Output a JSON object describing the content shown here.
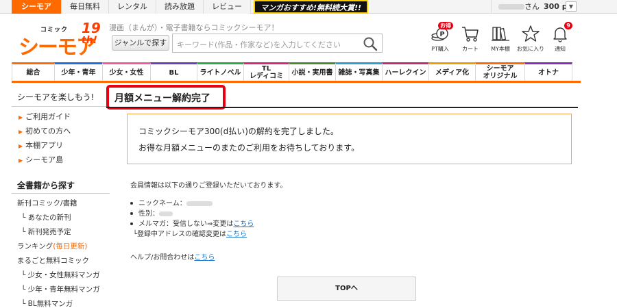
{
  "topnav": {
    "tabs": [
      {
        "label": "シーモア",
        "active": true
      },
      {
        "label": "毎日無料"
      },
      {
        "label": "レンタル"
      },
      {
        "label": "読み放題"
      },
      {
        "label": "レビュー"
      }
    ],
    "promo": "マンガおすすめ!無料読大賞!!",
    "user_suffix": "さん",
    "points": "300 pt",
    "dropdown_glyph": "▼"
  },
  "logo": {
    "small": "コミック",
    "main": "シーモア",
    "badge_number": "19",
    "badge_suffix": "th!"
  },
  "header": {
    "tagline": "漫画（まんが）・電子書籍ならコミックシーモア！",
    "genre_button": "ジャンルで探す",
    "search_placeholder": "キーワード(作品・作家など)を入力してください",
    "icons": [
      {
        "label": "PT購入",
        "icon": "coin-icon",
        "badge": "お得"
      },
      {
        "label": "カート",
        "icon": "cart-icon"
      },
      {
        "label": "MY本棚",
        "icon": "bookshelf-icon"
      },
      {
        "label": "お気に入り",
        "icon": "star-icon"
      },
      {
        "label": "通知",
        "icon": "bell-icon",
        "badge": "9"
      }
    ]
  },
  "categories": [
    {
      "label": "総合",
      "color": "#ff6a00"
    },
    {
      "label": "少年・青年",
      "color": "#1e6fd9"
    },
    {
      "label": "少女・女性",
      "color": "#f05a9b"
    },
    {
      "label": "BL",
      "color": "#6a3fb5"
    },
    {
      "label": "ライトノベル",
      "color": "#2aa84a"
    },
    {
      "label": "TL\nレディコミ",
      "color": "#d8257a"
    },
    {
      "label": "小説・実用書",
      "color": "#4a8a2a"
    },
    {
      "label": "雑誌・写真集",
      "color": "#2a9dd4"
    },
    {
      "label": "ハーレクイン",
      "color": "#c0287a"
    },
    {
      "label": "メディア化",
      "color": "#e8a000"
    },
    {
      "label": "シーモア\nオリジナル",
      "color": "#ff6a00"
    },
    {
      "label": "オトナ",
      "color": "#8a2ab5"
    }
  ],
  "sidebar": {
    "title": "シーモアを楽しもう!",
    "links": [
      "ご利用ガイド",
      "初めての方へ",
      "本棚アプリ",
      "シーモア島"
    ],
    "books_title": "全書籍から探す",
    "books": [
      {
        "label": "新刊コミック/書籍",
        "sub": false
      },
      {
        "label": "あなたの新刊",
        "sub": true
      },
      {
        "label": "新刊発売予定",
        "sub": true
      },
      {
        "label": "ランキング",
        "note": "(毎日更新)",
        "sub": false
      },
      {
        "label": "まるごと無料コミック",
        "sub": false
      },
      {
        "label": "少女・女性無料マンガ",
        "sub": true
      },
      {
        "label": "少年・青年無料マンガ",
        "sub": true
      },
      {
        "label": "BL無料マンガ",
        "sub": true
      }
    ],
    "sub_prefix": "└"
  },
  "main": {
    "title": "月額メニュー解約完了",
    "notice_line1": "コミックシーモア300(d払い)の解約を完了しました。",
    "notice_line2": "お得な月額メニューのまたのご利用をお待ちしております。",
    "info_intro": "会員情報は以下の通りご登録いただいております。",
    "nickname_label": "ニックネーム：",
    "gender_label": "性別：",
    "mailmag_label": "メルマガ：受信しない⇒変更は",
    "mailmag_link": "こちら",
    "email_confirm_label": "└登録中アドレスの確認変更は",
    "email_confirm_link": "こちら",
    "help_label": "ヘルプ/お問合わせは",
    "help_link": "こちら",
    "top_button": "TOPへ"
  },
  "colors": {
    "accent": "#ff6a00",
    "highlight_border": "#e60012",
    "link": "#1a73c8",
    "notice_border": "#f5a64a"
  }
}
